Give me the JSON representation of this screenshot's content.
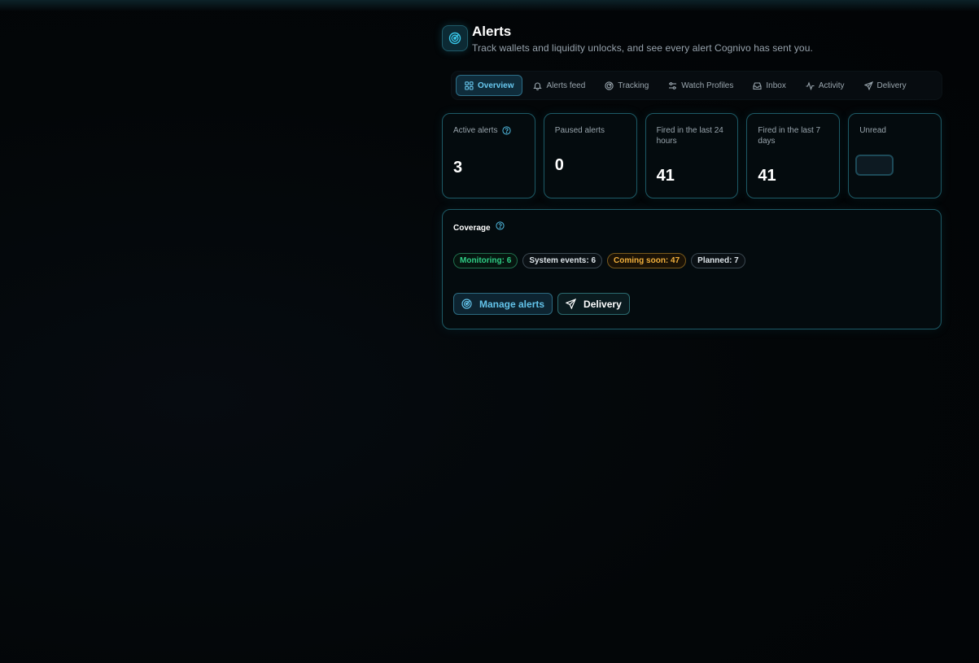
{
  "header": {
    "icon": "radar-icon",
    "title": "Alerts",
    "subtitle": "Track wallets and liquidity unlocks, and see every alert Cognivo has sent you."
  },
  "tabs": [
    {
      "label": "Overview",
      "icon": "grid-icon",
      "active": true
    },
    {
      "label": "Alerts feed",
      "icon": "bell-icon",
      "active": false
    },
    {
      "label": "Tracking",
      "icon": "radar-icon",
      "active": false
    },
    {
      "label": "Watch Profiles",
      "icon": "sliders-icon",
      "active": false
    },
    {
      "label": "Inbox",
      "icon": "inbox-icon",
      "active": false
    },
    {
      "label": "Activity",
      "icon": "activity-icon",
      "active": false
    },
    {
      "label": "Delivery",
      "icon": "send-icon",
      "active": false
    }
  ],
  "stats": [
    {
      "label": "Active alerts",
      "value": "3",
      "help": true
    },
    {
      "label": "Paused alerts",
      "value": "0"
    },
    {
      "label": "Fired in the last 24 hours",
      "value": "41"
    },
    {
      "label": "Fired in the last 7 days",
      "value": "41"
    },
    {
      "label": "Unread",
      "value": ""
    }
  ],
  "coverage": {
    "title": "Coverage",
    "pills": [
      {
        "label": "Monitoring: 6",
        "tone": "green"
      },
      {
        "label": "System events: 6",
        "tone": "gray"
      },
      {
        "label": "Coming soon: 47",
        "tone": "amber"
      },
      {
        "label": "Planned: 7",
        "tone": "gray"
      }
    ],
    "buttons": {
      "manage": "Manage alerts",
      "delivery": "Delivery"
    }
  },
  "colors": {
    "accent": "#68c8ef",
    "border": "#1d5a66",
    "green": "#2fcf86",
    "amber": "#f2b03c"
  }
}
